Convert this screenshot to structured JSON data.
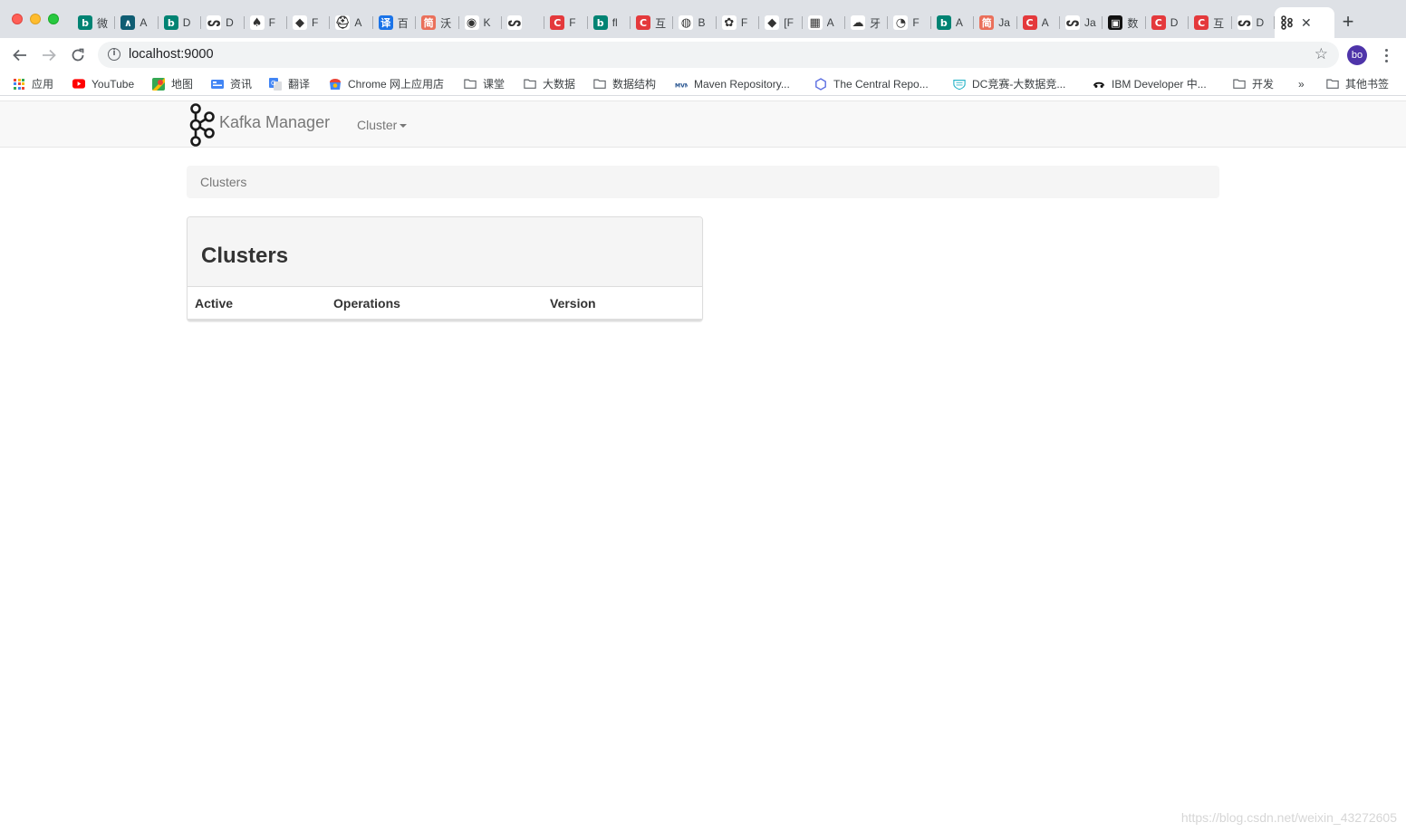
{
  "browser": {
    "tabs": [
      {
        "title": "微",
        "icon": "bing-icon",
        "color": "#008373",
        "glyph": "b"
      },
      {
        "title": "A",
        "icon": "aliyun-icon",
        "color": "#0f5d73",
        "glyph": "∧"
      },
      {
        "title": "D",
        "icon": "bing-icon",
        "color": "#008373",
        "glyph": "b"
      },
      {
        "title": "D",
        "icon": "bird-icon",
        "color": "#ffffff",
        "glyph": "ᔕ"
      },
      {
        "title": "F",
        "icon": "spade-icon",
        "color": "#ffffff",
        "glyph": "♠"
      },
      {
        "title": "F",
        "icon": "diamond-icon",
        "color": "#ffffff",
        "glyph": "◆"
      },
      {
        "title": "A",
        "icon": "hat-icon",
        "color": "#ffffff",
        "glyph": "⛑"
      },
      {
        "title": "百",
        "icon": "translate-icon",
        "color": "#1a73e8",
        "glyph": "译"
      },
      {
        "title": "沃",
        "icon": "jianshu-icon",
        "color": "#ea6f5a",
        "glyph": "简"
      },
      {
        "title": "K",
        "icon": "target-icon",
        "color": "#ffffff",
        "glyph": "◉"
      },
      {
        "title": "",
        "icon": "bird-icon",
        "color": "#ffffff",
        "glyph": "ᔕ"
      },
      {
        "title": "F",
        "icon": "csdn-icon",
        "color": "#e4393c",
        "glyph": "C"
      },
      {
        "title": "fl",
        "icon": "bing-icon",
        "color": "#008373",
        "glyph": "b"
      },
      {
        "title": "互",
        "icon": "csdn-icon",
        "color": "#e4393c",
        "glyph": "C"
      },
      {
        "title": "B",
        "icon": "globe-icon",
        "color": "#ffffff",
        "glyph": "◍"
      },
      {
        "title": "F",
        "icon": "paw-icon",
        "color": "#ffffff",
        "glyph": "✿"
      },
      {
        "title": "[F",
        "icon": "diamond-icon",
        "color": "#ffffff",
        "glyph": "◆"
      },
      {
        "title": "A",
        "icon": "bars-icon",
        "color": "#ffffff",
        "glyph": "▦"
      },
      {
        "title": "牙",
        "icon": "cloud-icon",
        "color": "#ffffff",
        "glyph": "☁"
      },
      {
        "title": "F",
        "icon": "github-icon",
        "color": "#ffffff",
        "glyph": "◔"
      },
      {
        "title": "A",
        "icon": "bing-icon",
        "color": "#008373",
        "glyph": "b"
      },
      {
        "title": "Ja",
        "icon": "jianshu-icon",
        "color": "#ea6f5a",
        "glyph": "简"
      },
      {
        "title": "A",
        "icon": "csdn-icon",
        "color": "#e4393c",
        "glyph": "C"
      },
      {
        "title": "Ja",
        "icon": "bird-icon",
        "color": "#ffffff",
        "glyph": "ᔕ"
      },
      {
        "title": "数",
        "icon": "dark-logo-icon",
        "color": "#111111",
        "glyph": "▣"
      },
      {
        "title": "D",
        "icon": "csdn-icon",
        "color": "#e4393c",
        "glyph": "C"
      },
      {
        "title": "互",
        "icon": "csdn-icon",
        "color": "#e4393c",
        "glyph": "C"
      },
      {
        "title": "D",
        "icon": "bird-icon",
        "color": "#ffffff",
        "glyph": "ᔕ"
      }
    ],
    "active_tab_icon": "kafka-icon",
    "url": "localhost:9000",
    "avatar_text": "bo",
    "bookmarks": [
      {
        "label": "应用",
        "icon": "apps-grid-icon",
        "x": 0
      },
      {
        "label": "YouTube",
        "icon": "youtube-icon",
        "x": 1
      },
      {
        "label": "地图",
        "icon": "maps-icon",
        "x": 2
      },
      {
        "label": "资讯",
        "icon": "news-icon",
        "x": 3
      },
      {
        "label": "翻译",
        "icon": "translate-icon",
        "x": 4
      },
      {
        "label": "Chrome 网上应用店",
        "icon": "webstore-icon",
        "x": 5
      },
      {
        "label": "课堂",
        "icon": "folder-icon",
        "x": 6
      },
      {
        "label": "大数据",
        "icon": "folder-icon",
        "x": 7
      },
      {
        "label": "数据结构",
        "icon": "folder-icon",
        "x": 8
      },
      {
        "label": "Maven Repository...",
        "icon": "maven-icon",
        "x": 9
      },
      {
        "label": "The Central Repo...",
        "icon": "hexagon-icon",
        "x": 10
      },
      {
        "label": "DC竞赛-大数据竞...",
        "icon": "dc-shield-icon",
        "x": 11
      },
      {
        "label": "IBM Developer 中...",
        "icon": "ibm-icon",
        "x": 12
      },
      {
        "label": "开发",
        "icon": "folder-icon",
        "x": 13
      }
    ],
    "overflow_label": "»",
    "other_bookmarks": "其他书签"
  },
  "navbar": {
    "brand": "Kafka Manager",
    "cluster_menu": "Cluster"
  },
  "breadcrumb": "Clusters",
  "panel": {
    "title": "Clusters",
    "columns": [
      "Active",
      "Operations",
      "Version"
    ]
  },
  "watermark": "https://blog.csdn.net/weixin_43272605"
}
